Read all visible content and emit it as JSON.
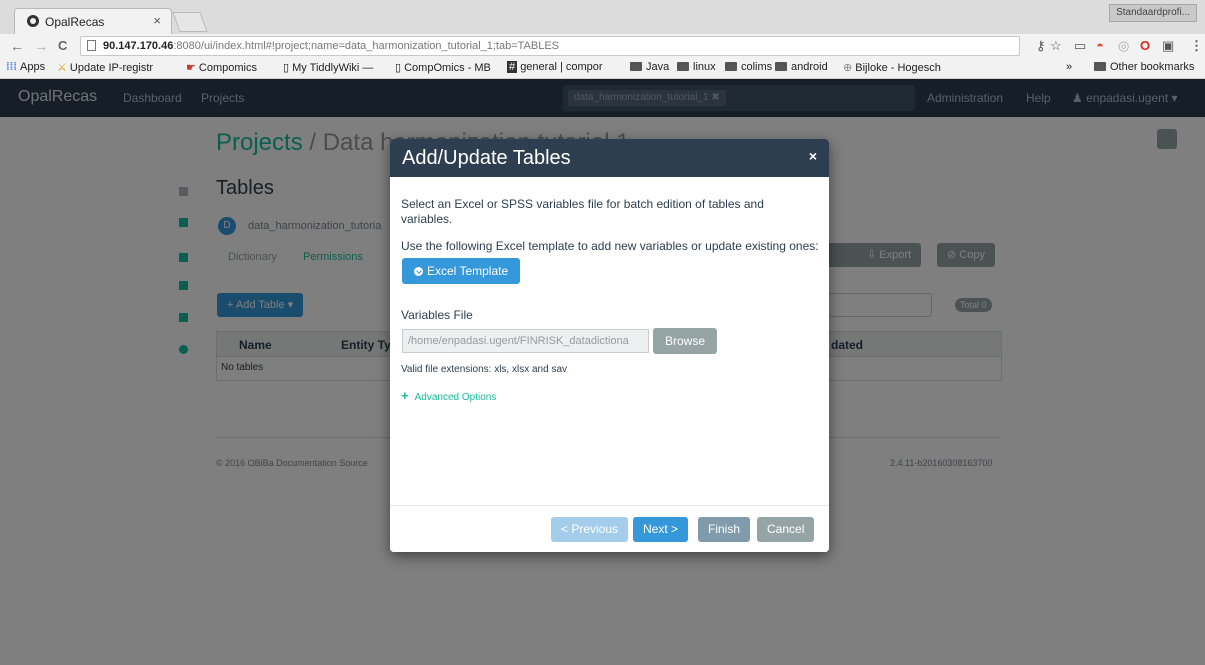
{
  "browser": {
    "tab_title": "OpalRecas",
    "tab_close": "×",
    "profile": "Standaardprofi...",
    "back": "←",
    "forward": "→",
    "reload": "C",
    "url_host": "90.147.170.46",
    "url_rest": ":8080/ui/index.html#!project;name=data_harmonization_tutorial_1;tab=TABLES",
    "bookmarks": [
      "Apps",
      "Update IP-registr",
      "Compomics",
      "My TiddlyWiki —",
      "CompOmics - MB",
      "general | compor",
      "Java",
      "linux",
      "colims",
      "android",
      "Bijloke - Hogesch"
    ],
    "overflow": "»",
    "other_bookmarks": "Other bookmarks"
  },
  "appnav": {
    "brand": "OpalRecas",
    "dashboard": "Dashboard",
    "projects": "Projects",
    "search_chip": "data_harmonization_tutorial_1  ✖",
    "administration": "Administration",
    "help": "Help",
    "user": "enpadasi.ugent ▾"
  },
  "page": {
    "breadcrumb_root": "Projects",
    "breadcrumb_sep": " / ",
    "breadcrumb_project": "Data harmonization tutorial 1",
    "section_title": "Tables",
    "datasource_badge": "D",
    "datasource_name": "data_harmonization_tutoria",
    "tab_dictionary": "Dictionary",
    "tab_permissions": "Permissions",
    "add_table": "+ Add Table ▾",
    "export": "Export",
    "copy": "Copy",
    "total": "Total 0",
    "col_name": "Name",
    "col_entity": "Entity Typ",
    "col_updated": "dated",
    "empty": "No tables",
    "footer_left": "© 2016 OBiBa  Documentation  Source",
    "footer_right": "2.4.11-b20160308163700"
  },
  "modal": {
    "title": "Add/Update Tables",
    "close": "×",
    "intro_line1": "Select an Excel or SPSS variables file for batch edition of tables and",
    "intro_line2": "variables.",
    "template_text": "Use the following Excel template to add new variables or update existing ones:",
    "excel_template": "Excel Template",
    "variables_file_label": "Variables File",
    "file_path": "/home/enpadasi.ugent/FINRISK_datadictiona",
    "browse": "Browse",
    "valid_ext": "Valid file extensions: xls, xlsx and sav",
    "advanced": "Advanced Options",
    "previous": "< Previous",
    "next": "Next >",
    "finish": "Finish",
    "cancel": "Cancel"
  }
}
